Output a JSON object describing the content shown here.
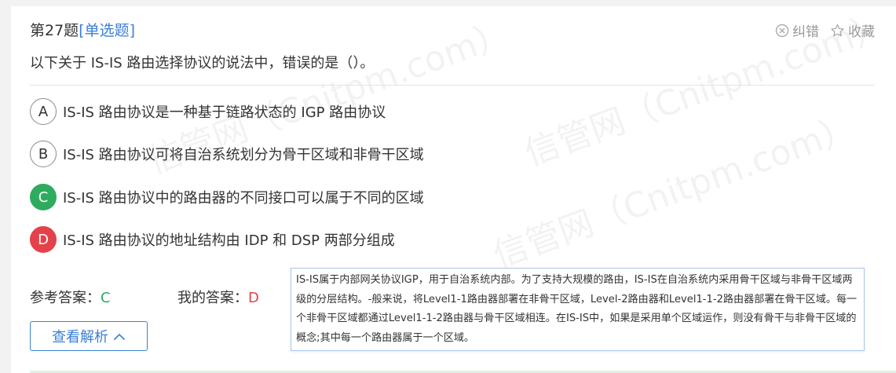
{
  "question": {
    "number_label": "第27题",
    "type_label": "[单选题]",
    "text": "以下关于 IS-IS 路由选择协议的说法中，错误的是（）。"
  },
  "actions": {
    "report_label": "纠错",
    "favorite_label": "收藏"
  },
  "options": [
    {
      "letter": "A",
      "text": "IS-IS 路由协议是一种基于链路状态的 IGP 路由协议",
      "state": "normal"
    },
    {
      "letter": "B",
      "text": "IS-IS 路由协议可将自治系统划分为骨干区域和非骨干区域",
      "state": "normal"
    },
    {
      "letter": "C",
      "text": "IS-IS 路由协议中的路由器的不同接口可以属于不同的区域",
      "state": "correct"
    },
    {
      "letter": "D",
      "text": "IS-IS 路由协议的地址结构由 IDP 和 DSP 两部分组成",
      "state": "wrong"
    }
  ],
  "answers": {
    "reference_label": "参考答案：",
    "reference_value": "C",
    "mine_label": "我的答案：",
    "mine_value": "D"
  },
  "analysis_button": {
    "label": "查看解析"
  },
  "explanation": {
    "text": "IS-IS属于内部网关协议IGP，用于自治系统内部。为了支持大规模的路由，IS-IS在自治系统内采用骨干区域与非骨干区域两级的分层结构。-般来说，将Level1-1路由器部署在非骨干区域，Level-2路由器和Level1-1-2路由器部署在骨干区域。每一个非骨干区域都通过Level1-1-2路由器与骨干区域相连。在IS-IS中，如果是采用单个区域运作，则没有骨干与非骨干区域的概念;其中每一个路由器属于一个区域。"
  },
  "watermark": {
    "text": "信管网（Cnitpm.com）"
  },
  "colors": {
    "accent": "#3a7fd6",
    "correct": "#2eab5f",
    "wrong": "#e5414a"
  }
}
